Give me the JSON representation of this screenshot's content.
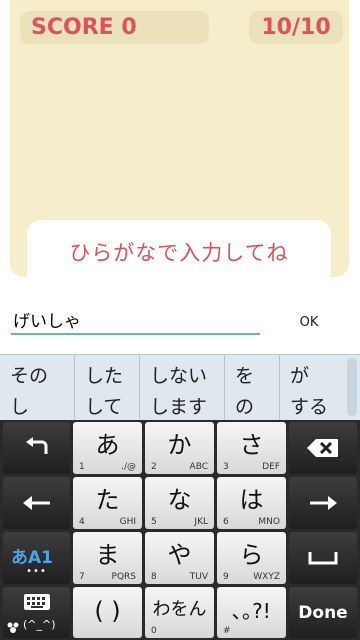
{
  "game": {
    "score_label": "SCORE 0",
    "progress_label": "10/10",
    "prompt": "ひらがなで入力してね"
  },
  "input": {
    "value": "げいしゃ",
    "ok_label": "OK"
  },
  "suggestions": [
    {
      "line1": "その",
      "line2": "し"
    },
    {
      "line1": "した",
      "line2": "して"
    },
    {
      "line1": "しない",
      "line2": "します"
    },
    {
      "line1": "を",
      "line2": "の"
    },
    {
      "line1": "が",
      "line2": "する"
    }
  ],
  "keys": {
    "a": {
      "main": "あ",
      "num": "1",
      "sub": "./@"
    },
    "ka": {
      "main": "か",
      "num": "2",
      "sub": "ABC"
    },
    "sa": {
      "main": "さ",
      "num": "3",
      "sub": "DEF"
    },
    "ta": {
      "main": "た",
      "num": "4",
      "sub": "GHI"
    },
    "na": {
      "main": "な",
      "num": "5",
      "sub": "JKL"
    },
    "ha": {
      "main": "は",
      "num": "6",
      "sub": "MNO"
    },
    "ma": {
      "main": "ま",
      "num": "7",
      "sub": "PQRS"
    },
    "ya": {
      "main": "や",
      "num": "8",
      "sub": "TUV"
    },
    "ra": {
      "main": "ら",
      "num": "9",
      "sub": "WXYZ"
    },
    "paren": {
      "main": "( )"
    },
    "wa": {
      "main": "わをん",
      "num": "0"
    },
    "punct": {
      "main": "､｡?!",
      "num": "#"
    },
    "mode": {
      "label": "あA1",
      "dots": "•••"
    },
    "emoji_label": "(^_^)",
    "done_label": "Done"
  },
  "colors": {
    "accent": "#e0525a",
    "board": "#f6eecb",
    "pill": "#ebe2bb",
    "input_underline": "#6bb6b0",
    "mode_blue": "#49a6e6"
  }
}
